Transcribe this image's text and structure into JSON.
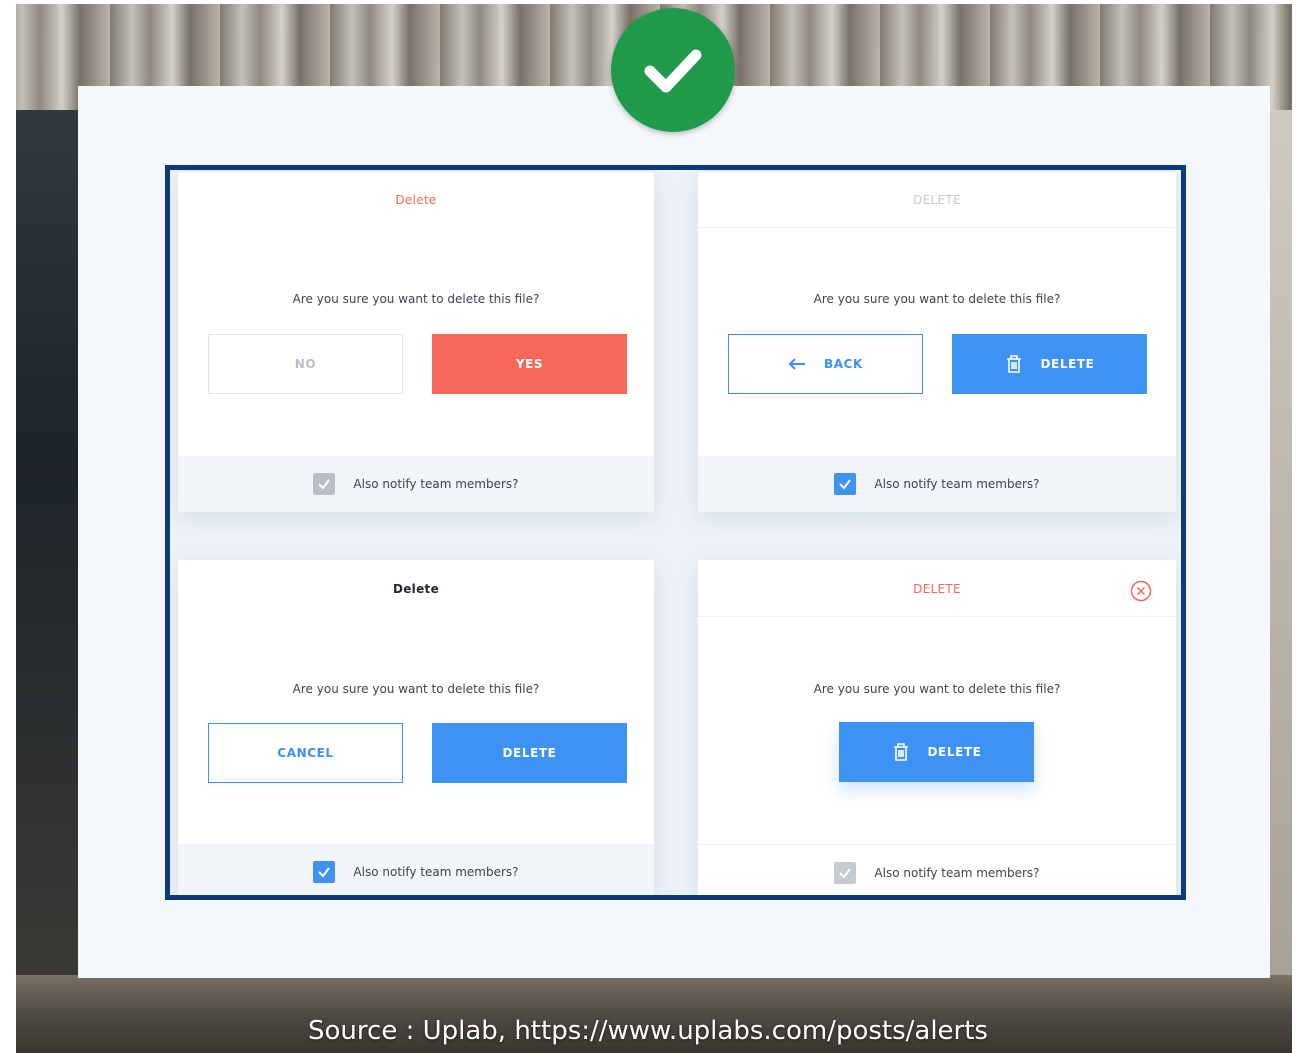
{
  "badge": {
    "icon": "check-icon",
    "color": "#1e9a4a"
  },
  "dialogs": [
    {
      "title": "Delete",
      "title_color": "#f7675a",
      "question": "Are you sure you want to delete this file?",
      "buttons": [
        {
          "label": "NO",
          "style": "outline-gray"
        },
        {
          "label": "YES",
          "style": "coral"
        }
      ],
      "notify": {
        "label": "Also notify team members?",
        "checked": true,
        "checkbox_color": "#b9bec6"
      }
    },
    {
      "title": "DELETE",
      "title_color": "#c6cbd2",
      "question": "Are you sure you want to delete this file?",
      "buttons": [
        {
          "label": "BACK",
          "style": "outline-blue",
          "icon": "arrow-left-icon"
        },
        {
          "label": "DELETE",
          "style": "blue",
          "icon": "trash-icon"
        }
      ],
      "notify": {
        "label": "Also notify team members?",
        "checked": true,
        "checkbox_color": "#3d92f2"
      }
    },
    {
      "title": "Delete",
      "title_color": "#1f2530",
      "question": "Are you sure you want to delete this file?",
      "buttons": [
        {
          "label": "CANCEL",
          "style": "outline-blue"
        },
        {
          "label": "DELETE",
          "style": "blue"
        }
      ],
      "notify": {
        "label": "Also notify team members?",
        "checked": true,
        "checkbox_color": "#3d92f2"
      }
    },
    {
      "title": "DELETE",
      "title_color": "#f7675a",
      "close_icon": "close-circle-icon",
      "question": "Are you sure you want to delete this file?",
      "buttons": [
        {
          "label": "DELETE",
          "style": "blue",
          "icon": "trash-icon"
        }
      ],
      "notify": {
        "label": "Also notify team members?",
        "checked": true,
        "checkbox_color": "#c6cbd2"
      }
    }
  ],
  "source": "Source : Uplab, https://www.uplabs.com/posts/alerts"
}
